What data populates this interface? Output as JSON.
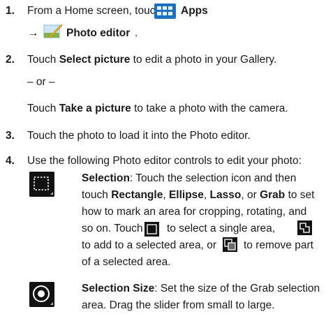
{
  "steps": [
    {
      "number": "1.",
      "line1_prefix": "From a Home screen, touch",
      "apps_label": "Apps",
      "arrow": "→",
      "photo_editor_label": "Photo editor",
      "photo_editor_suffix": "."
    },
    {
      "number": "2.",
      "touch": "Touch",
      "select_picture": "Select picture",
      "select_suffix": "to edit a photo in your Gallery.",
      "or": "– or –",
      "touch2": "Touch",
      "take_picture": "Take a picture",
      "take_suffix": "to take a photo with the camera."
    },
    {
      "number": "3.",
      "text": "Touch the photo to load it into the Photo editor."
    },
    {
      "number": "4.",
      "text": "Use the following Photo editor controls to edit your photo:"
    }
  ],
  "controls": {
    "selection": {
      "title": "Selection",
      "l1": ": Touch the selection icon and then",
      "l2_touch": "touch",
      "rectangle": "Rectangle",
      "comma1": ",",
      "ellipse": "Ellipse",
      "comma2": ",",
      "lasso": "Lasso",
      "or_word": ", or",
      "grab": "Grab",
      "l2_end": "to set",
      "l3": "how to mark an area for cropping, rotating, and",
      "l4a": "so on. Touch",
      "l4b": "to select a single area,",
      "l5a": "to add to a selected area, or",
      "l5b": "to remove part",
      "l6": "of a selected area."
    },
    "selection_size": {
      "title": "Selection Size",
      "l1": ": Set the size of the Grab selection",
      "l2": "area. Drag the slider from small to large."
    }
  },
  "icons": {
    "apps": "apps-grid-icon",
    "photo_editor": "photo-editor-icon",
    "selection": "selection-icon",
    "single_area": "single-area-icon",
    "add_area": "add-area-icon",
    "remove_area": "remove-area-icon",
    "selection_size": "selection-size-icon"
  },
  "colors": {
    "apps_icon": "#1d6fc0",
    "dark_icon": "#121212"
  }
}
